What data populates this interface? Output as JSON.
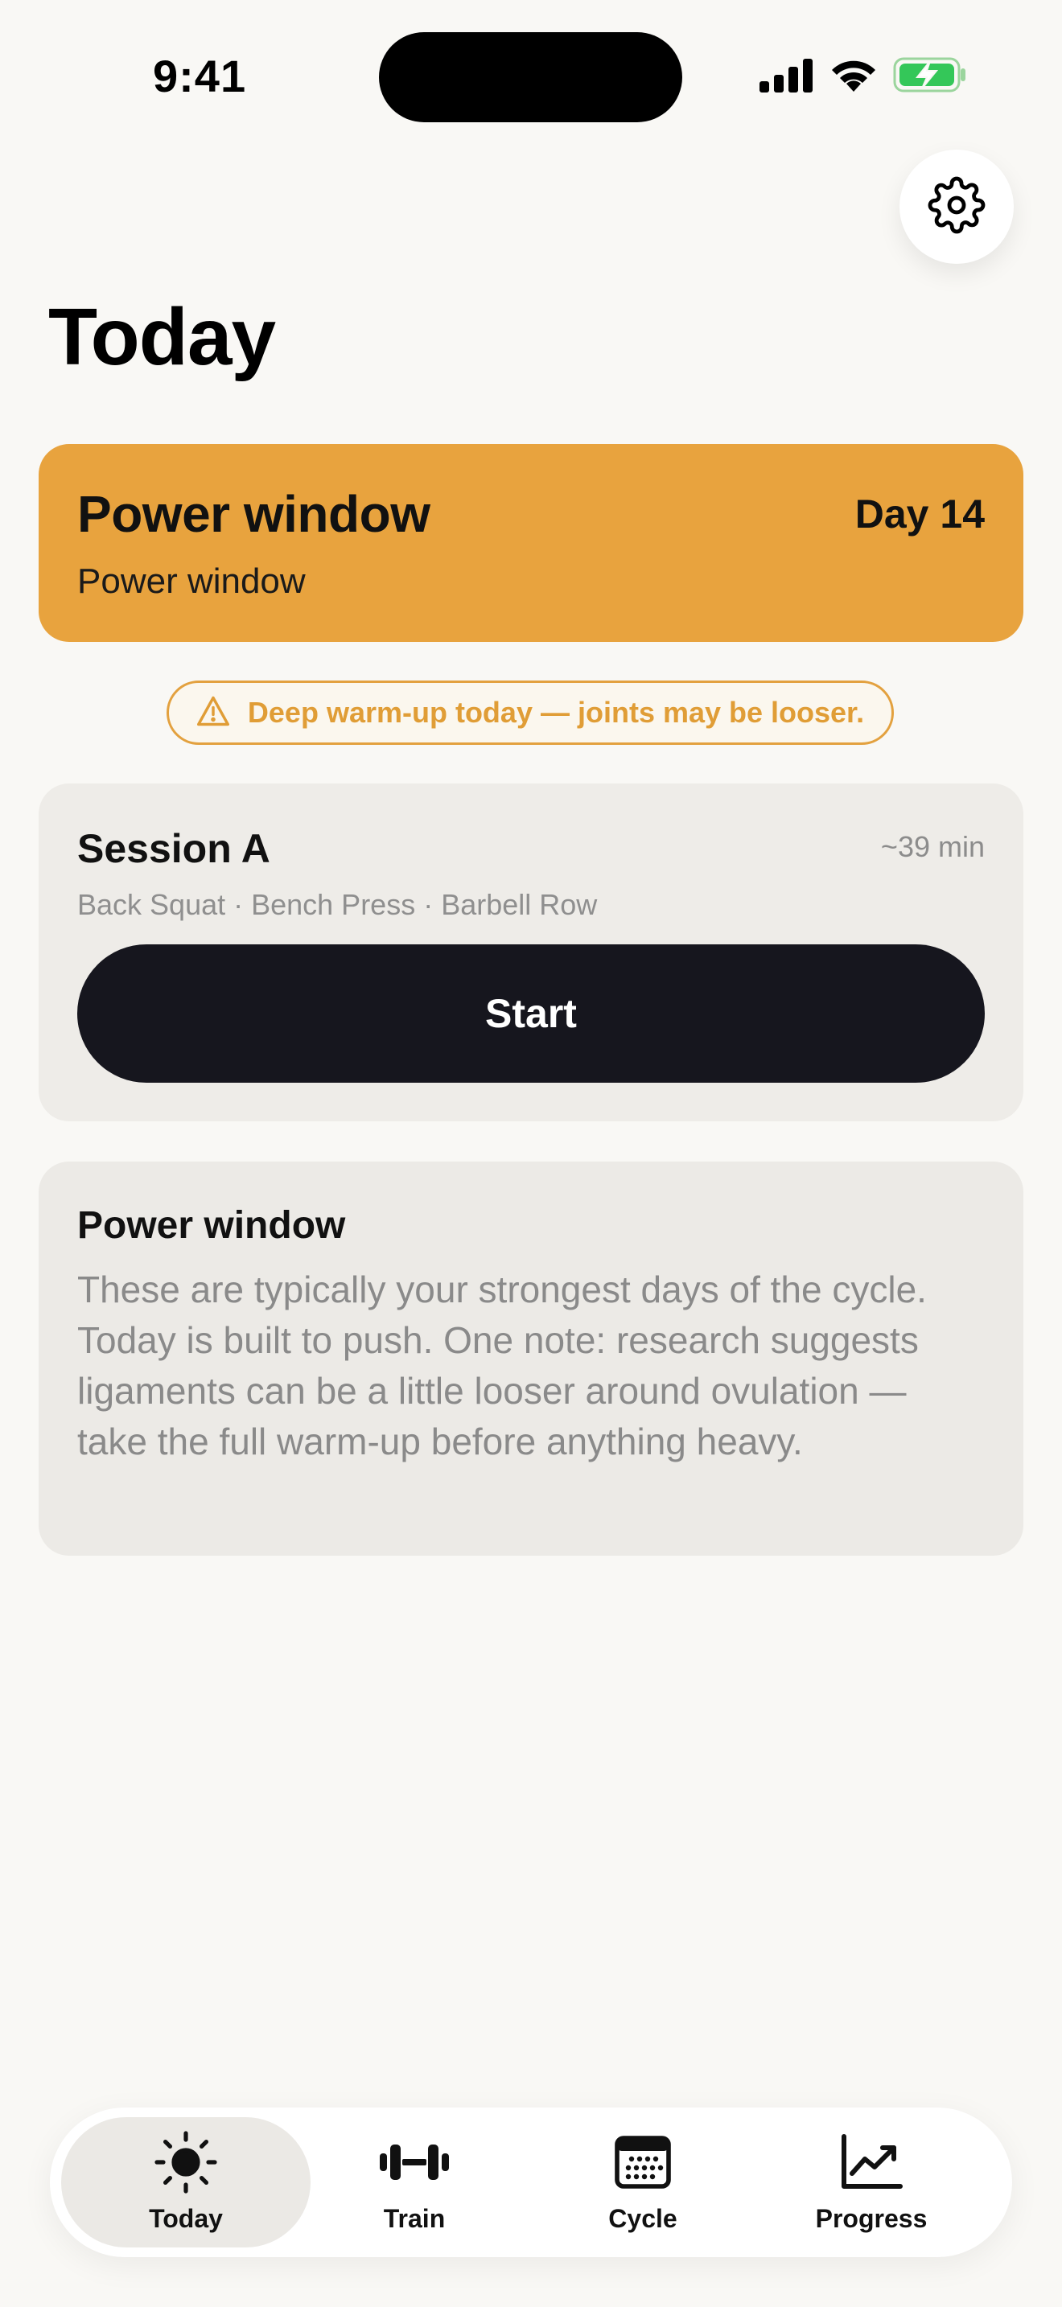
{
  "status_bar": {
    "time": "9:41",
    "icons": [
      "cellular-signal-icon",
      "wifi-icon",
      "battery-charging-icon"
    ]
  },
  "header": {
    "settings_icon": "gear-icon",
    "title": "Today"
  },
  "phase": {
    "title": "Power window",
    "day": "Day 14",
    "subtitle": "Power window",
    "color": "#e8a33e"
  },
  "warning": {
    "icon": "warning-triangle-icon",
    "text": "Deep warm-up today — joints may be looser.",
    "color": "#e09d36"
  },
  "session": {
    "title": "Session A",
    "duration": "~39 min",
    "exercises": "Back Squat · Bench Press · Barbell Row",
    "start_label": "Start"
  },
  "info": {
    "title": "Power window",
    "body": "These are typically your strongest days of the cycle. Today is built to push. One note: research suggests ligaments can be a little looser around ovulation — take the full warm-up before anything heavy."
  },
  "tabs": [
    {
      "label": "Today",
      "icon": "sun-icon",
      "active": true
    },
    {
      "label": "Train",
      "icon": "dumbbell-icon",
      "active": false
    },
    {
      "label": "Cycle",
      "icon": "calendar-icon",
      "active": false
    },
    {
      "label": "Progress",
      "icon": "chart-line-icon",
      "active": false
    }
  ]
}
